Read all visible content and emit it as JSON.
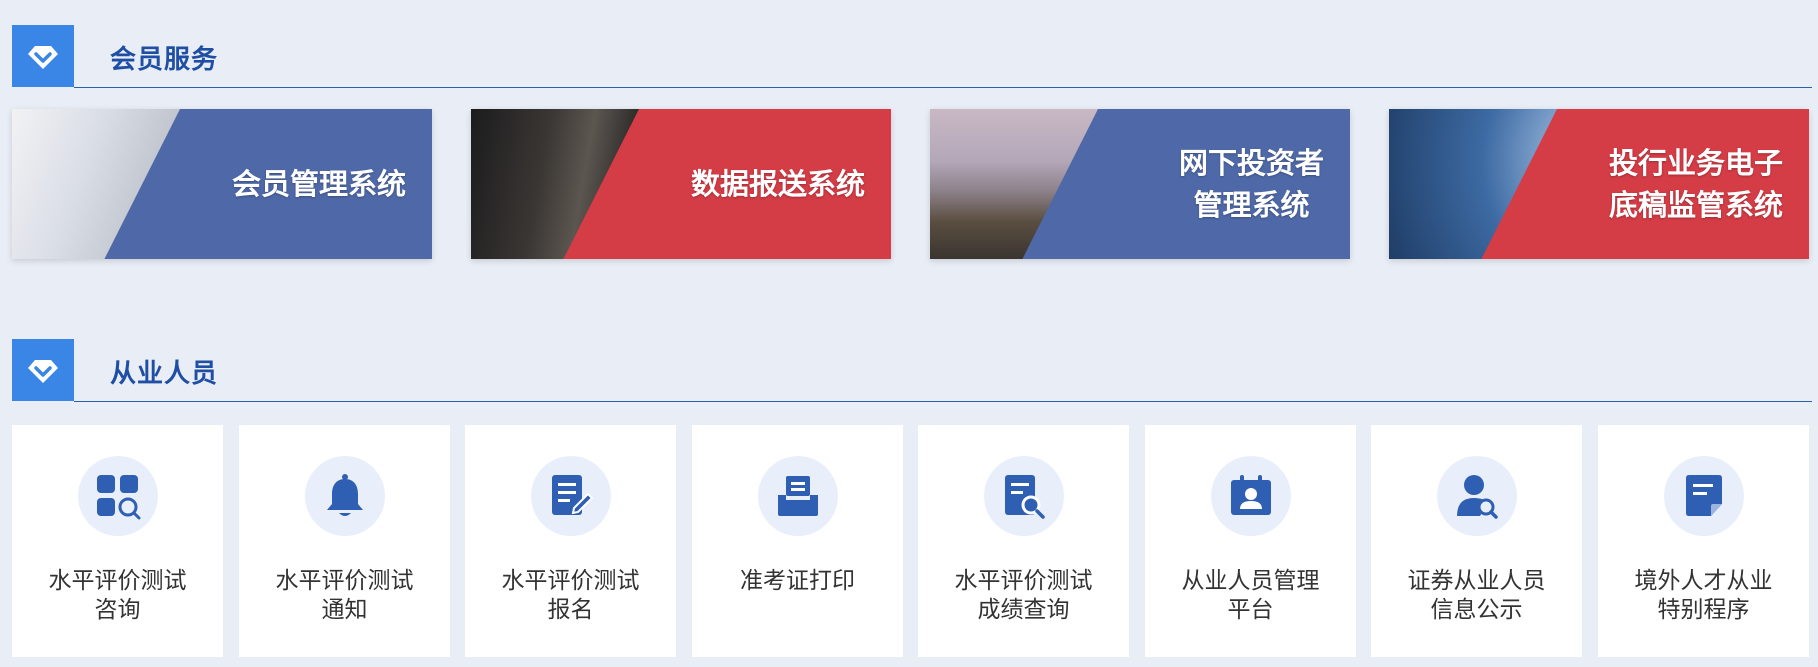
{
  "member_services": {
    "title": "会员服务",
    "banners": [
      {
        "label": "会员管理系统",
        "color": "#4f69a8"
      },
      {
        "label": "数据报送系统",
        "color": "#d43c46"
      },
      {
        "label": "网下投资者\n管理系统",
        "color": "#4f69a8"
      },
      {
        "label": "投行业务电子\n底稿监管系统",
        "color": "#d43c46"
      }
    ]
  },
  "practitioners": {
    "title": "从业人员",
    "cards": [
      {
        "label": "水平评价测试\n咨询",
        "icon": "apps-search-icon"
      },
      {
        "label": "水平评价测试\n通知",
        "icon": "bell-icon"
      },
      {
        "label": "水平评价测试\n报名",
        "icon": "edit-document-icon"
      },
      {
        "label": "准考证打印",
        "icon": "printer-icon"
      },
      {
        "label": "水平评价测试\n成绩查询",
        "icon": "document-search-icon"
      },
      {
        "label": "从业人员管理\n平台",
        "icon": "id-card-icon"
      },
      {
        "label": "证券从业人员\n信息公示",
        "icon": "user-search-icon"
      },
      {
        "label": "境外人才从业\n特别程序",
        "icon": "document-icon"
      }
    ]
  },
  "colors": {
    "accent": "#3a86e6",
    "icon_blue": "#2f5fb2",
    "icon_bg": "#e8eefa"
  }
}
